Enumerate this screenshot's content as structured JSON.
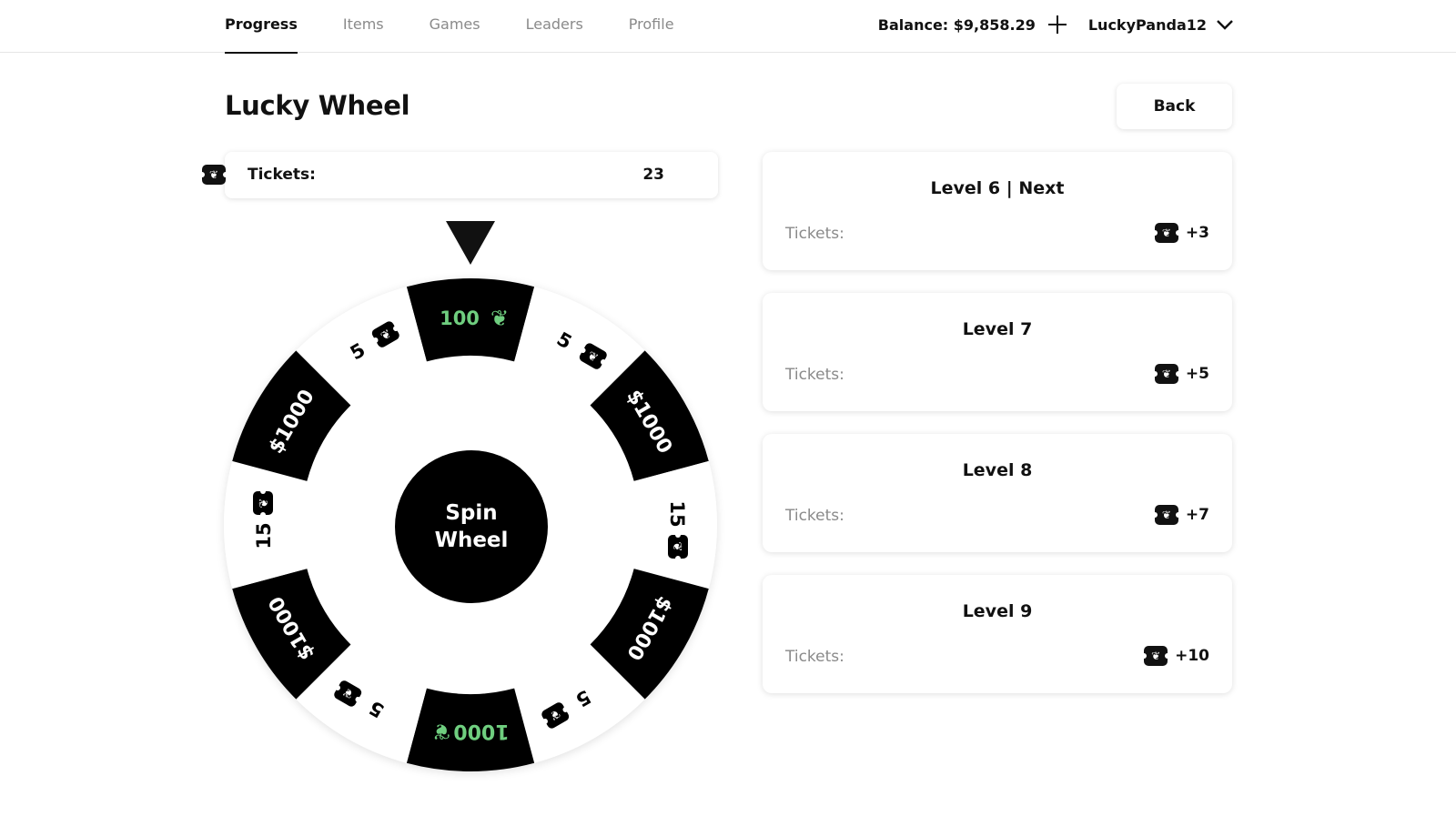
{
  "nav": {
    "items": [
      {
        "label": "Progress",
        "active": true
      },
      {
        "label": "Items",
        "active": false
      },
      {
        "label": "Games",
        "active": false
      },
      {
        "label": "Leaders",
        "active": false
      },
      {
        "label": "Profile",
        "active": false
      }
    ],
    "balance": "Balance: $9,858.29",
    "username": "LuckyPanda12"
  },
  "page": {
    "title": "Lucky Wheel",
    "back_label": "Back"
  },
  "tickets": {
    "label": "Tickets:",
    "count": "23"
  },
  "wheel": {
    "spin_label_line1": "Spin",
    "spin_label_line2": "Wheel",
    "segments": [
      {
        "label": "100",
        "style": "dark",
        "accent": "green",
        "icon": "leaf-icon"
      },
      {
        "label": "5",
        "style": "light",
        "icon": "ticket-icon"
      },
      {
        "label": "$1000",
        "style": "dark",
        "icon": ""
      },
      {
        "label": "15",
        "style": "light",
        "icon": "ticket-icon"
      },
      {
        "label": "$1000",
        "style": "dark",
        "icon": ""
      },
      {
        "label": "5",
        "style": "light",
        "icon": "ticket-icon"
      },
      {
        "label": "1000",
        "style": "dark",
        "accent": "green",
        "icon": "leaf-icon"
      },
      {
        "label": "5",
        "style": "light",
        "icon": "ticket-icon"
      },
      {
        "label": "$1000",
        "style": "dark",
        "icon": ""
      },
      {
        "label": "15",
        "style": "light",
        "icon": "ticket-icon"
      },
      {
        "label": "$1000",
        "style": "dark",
        "icon": ""
      },
      {
        "label": "5",
        "style": "light",
        "icon": "ticket-icon"
      }
    ],
    "colors": {
      "dark": "#000000",
      "light": "#ffffff",
      "green": "#6fce7f"
    }
  },
  "levels": [
    {
      "title": "Level 6 | Next",
      "label": "Tickets:",
      "reward": "+3"
    },
    {
      "title": "Level 7",
      "label": "Tickets:",
      "reward": "+5"
    },
    {
      "title": "Level 8",
      "label": "Tickets:",
      "reward": "+7"
    },
    {
      "title": "Level 9",
      "label": "Tickets:",
      "reward": "+10"
    }
  ]
}
